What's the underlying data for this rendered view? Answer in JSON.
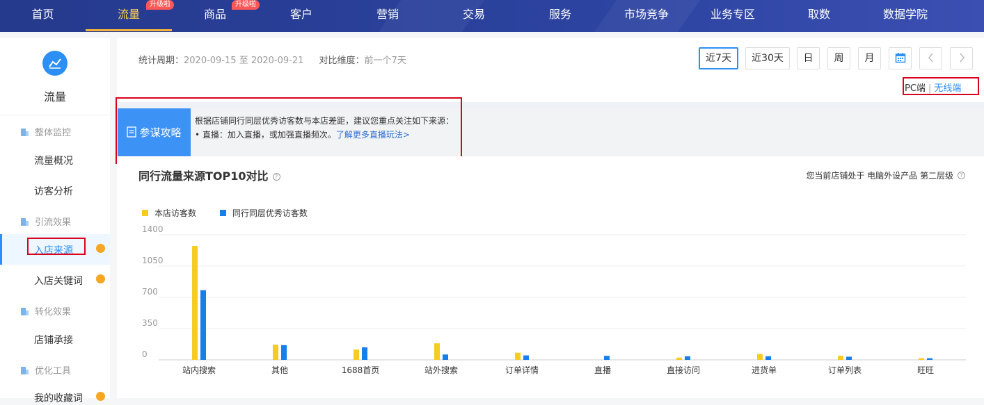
{
  "nav": {
    "items": [
      "首页",
      "流量",
      "商品",
      "客户",
      "营销",
      "交易",
      "服务",
      "市场竞争",
      "业务专区",
      "取数",
      "数据学院"
    ],
    "badge": "升级啦",
    "active_color": "#ffd24a"
  },
  "sidebar": {
    "title": "流量",
    "groups": [
      {
        "label": "整体监控",
        "items": [
          "流量概况",
          "访客分析"
        ]
      },
      {
        "label": "引流效果",
        "items": [
          "入店来源",
          "入店关键词"
        ]
      },
      {
        "label": "转化效果",
        "items": [
          "店铺承接"
        ]
      },
      {
        "label": "优化工具",
        "items": [
          "我的收藏词"
        ]
      }
    ],
    "active_item": "入店来源"
  },
  "header": {
    "period_label": "统计周期：",
    "period_value": "2020-09-15 至 2020-09-21",
    "compare_label": "对比维度：",
    "compare_value": "前一个7天",
    "buttons": [
      "近7天",
      "近30天",
      "日",
      "周",
      "月"
    ],
    "selected_button": "近7天",
    "calendar_icon": "calendar-icon",
    "prev_icon": "chevron-left-icon",
    "next_icon": "chevron-right-icon",
    "terminal_pc": "PC端",
    "terminal_sep": "|",
    "terminal_wireless": "无线端"
  },
  "strategy": {
    "tag": "参谋攻略",
    "line1": "根据店铺同行同层优秀访客数与本店差距，建议您重点关注如下来源：",
    "line2_bullet": "•",
    "line2": "直播：加入直播，或加强直播频次。",
    "link": "了解更多直播玩法>"
  },
  "chart_panel": {
    "title": "同行流量来源TOP10对比",
    "level_text": "您当前店铺处于 电脑外设产品 第二层级"
  },
  "chart_data": {
    "type": "bar",
    "categories": [
      "站内搜索",
      "其他",
      "1688首页",
      "站外搜索",
      "订单详情",
      "直播",
      "直接访问",
      "进货单",
      "订单列表",
      "旺旺"
    ],
    "series": [
      {
        "name": "本店访客数",
        "color": "#f5cc1f",
        "values": [
          1275,
          170,
          115,
          185,
          80,
          0,
          25,
          65,
          45,
          18
        ]
      },
      {
        "name": "同行同层优秀访客数",
        "color": "#1a7ee8",
        "values": [
          780,
          165,
          140,
          60,
          50,
          45,
          40,
          40,
          35,
          18
        ]
      }
    ],
    "yticks": [
      "0",
      "350",
      "700",
      "1050",
      "1400"
    ],
    "ylim": [
      0,
      1400
    ],
    "grid": true,
    "legend_position": "top-left"
  }
}
